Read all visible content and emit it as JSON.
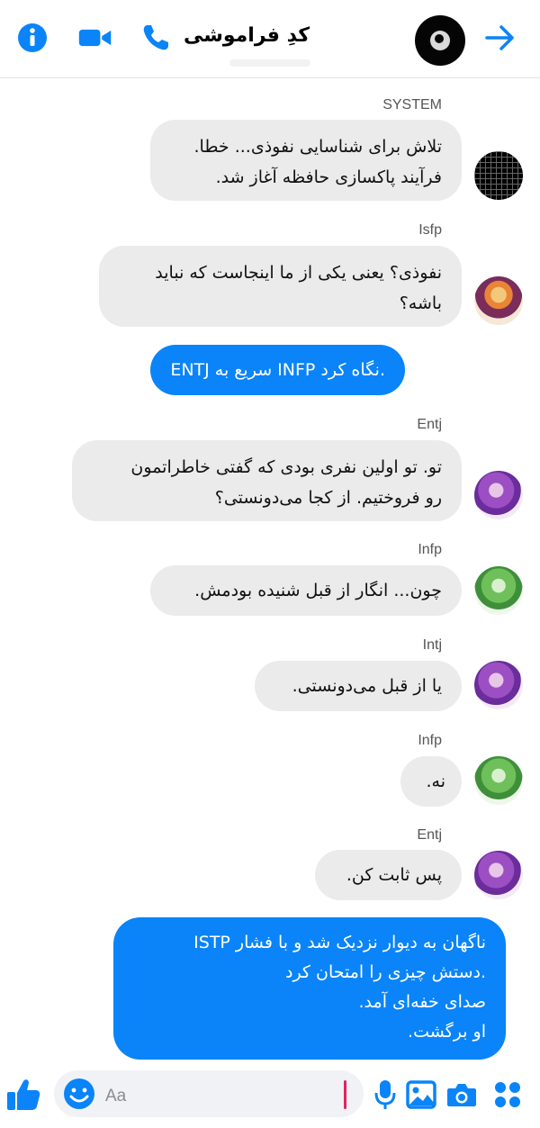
{
  "header": {
    "title": "کدِ فراموشی",
    "icons": [
      "info-icon",
      "video-call-icon",
      "phone-icon",
      "forward-arrow-icon"
    ],
    "accent": "#0a84f8"
  },
  "messages": [
    {
      "sender": "SYSTEM",
      "text": [
        "تلاش برای شناسایی نفوذی... خطا.",
        "فرآیند پاکسازی حافظه آغاز شد."
      ]
    },
    {
      "sender": "Isfp",
      "text": [
        "نفوذی؟ یعنی یکی از ما اینجاست که نباید",
        "باشه؟"
      ]
    },
    {
      "text": [
        ".نگاه کرد INFP سریع به ENTJ"
      ]
    },
    {
      "sender": "Entj",
      "text": [
        "تو. تو اولین نفری بودی که گفتی خاطراتمون",
        "رو فروختیم. از کجا می‌دونستی؟"
      ]
    },
    {
      "sender": "Infp",
      "text": [
        "چون... انگار از قبل شنیده بودمش."
      ]
    },
    {
      "sender": "Intj",
      "text": [
        "یا از قبل می‌دونستی."
      ]
    },
    {
      "sender": "Infp",
      "text": [
        "نه."
      ]
    },
    {
      "sender": "Entj",
      "text": [
        "پس ثابت کن."
      ]
    },
    {
      "text": [
        "ناگهان به دیوار نزدیک شد و با فشار ISTP",
        ".دستش چیزی را امتحان کرد",
        "صدای خفه‌ای آمد.",
        "او برگشت."
      ]
    }
  ],
  "composer": {
    "placeholder": "Aa",
    "icons": [
      "like-icon",
      "emoji-icon",
      "microphone-icon",
      "gallery-icon",
      "camera-icon",
      "apps-icon"
    ]
  }
}
